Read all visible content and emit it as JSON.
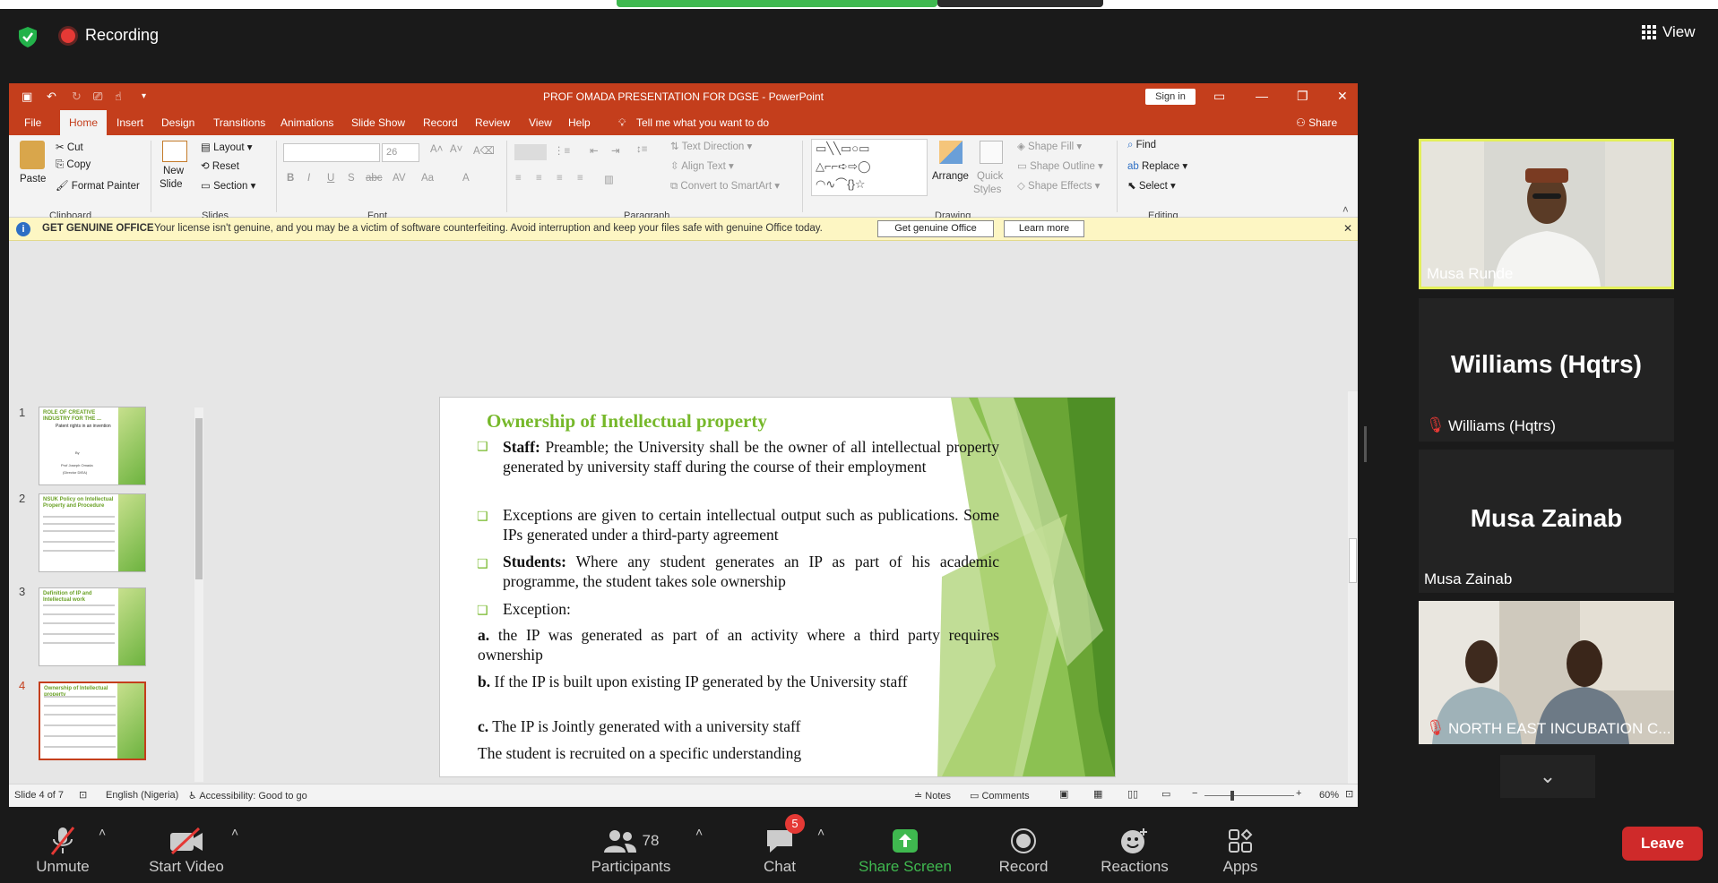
{
  "zoom": {
    "recording_label": "Recording",
    "view_label": "View",
    "leave_label": "Leave",
    "controls": {
      "unmute": "Unmute",
      "start_video": "Start Video",
      "participants": "Participants",
      "participants_count": "78",
      "chat": "Chat",
      "chat_badge": "5",
      "share_screen": "Share Screen",
      "record": "Record",
      "reactions": "Reactions",
      "apps": "Apps"
    },
    "tiles": [
      {
        "name": "Musa Runde"
      },
      {
        "big_name": "Williams (Hqtrs)",
        "name": "Williams (Hqtrs)"
      },
      {
        "big_name": "Musa Zainab",
        "name": "Musa Zainab"
      },
      {
        "name": "NORTH EAST INCUBATION C..."
      }
    ],
    "colors": {
      "accent_green": "#3fb84f",
      "active_speaker": "#e3ef5a",
      "leave": "#cf2a2a"
    }
  },
  "ppt": {
    "title": "PROF OMADA PRESENTATION FOR DGSE  -  PowerPoint",
    "sign_in": "Sign in",
    "share": "Share",
    "tabs": [
      "File",
      "Home",
      "Insert",
      "Design",
      "Transitions",
      "Animations",
      "Slide Show",
      "Record",
      "Review",
      "View",
      "Help"
    ],
    "tell_me": "Tell me what you want to do",
    "ribbon": {
      "paste": "Paste",
      "cut": "Cut",
      "copy": "Copy",
      "format_painter": "Format Painter",
      "clipboard": "Clipboard",
      "new_slide": "New",
      "new_slide2": "Slide",
      "layout": "Layout",
      "reset": "Reset",
      "section": "Section",
      "slides": "Slides",
      "font_size": "26",
      "font": "Font",
      "text_direction": "Text Direction",
      "align_text": "Align Text",
      "convert_smartart": "Convert to SmartArt",
      "paragraph": "Paragraph",
      "arrange": "Arrange",
      "quick_styles": "Quick",
      "quick_styles2": "Styles",
      "shape_fill": "Shape Fill",
      "shape_outline": "Shape Outline",
      "shape_effects": "Shape Effects",
      "drawing": "Drawing",
      "find": "Find",
      "replace": "Replace",
      "select": "Select",
      "editing": "Editing"
    },
    "license": {
      "heading": "GET GENUINE OFFICE",
      "message": "Your license isn't genuine, and you may be a victim of software counterfeiting. Avoid interruption and keep your files safe with genuine Office today.",
      "btn_get": "Get genuine Office",
      "btn_learn": "Learn more"
    },
    "thumbnails": [
      {
        "num": "1",
        "title": "ROLE OF CREATIVE INDUSTRY FOR THE ...",
        "sub": "Patent rights in an invention",
        "by": "By",
        "author": "Prof Joseph Omada",
        "role": "(Director DIEA)"
      },
      {
        "num": "2",
        "title": "NSUK Policy on Intellectual Property and Procedure"
      },
      {
        "num": "3",
        "title": "Definition of IP and Intellectual work"
      },
      {
        "num": "4",
        "title": "Ownership of Intellectual property"
      }
    ],
    "slide": {
      "title": "Ownership of Intellectual property",
      "p1_bold": "Staff:",
      "p1": " Preamble; the University shall be the owner of all intellectual property generated by university staff during the course of their employment",
      "p2": "Exceptions are given to certain intellectual output such as publications. Some IPs generated under a third-party agreement",
      "p3_bold": "Students:",
      "p3": " Where any student generates an IP as part of his academic programme, the student takes sole ownership",
      "p4": "Exception:",
      "a_bold": "a.",
      "a": " the IP was generated as part of an activity where a third party requires ownership",
      "b_bold": "b.",
      "b": " If the IP is built upon existing IP generated by the University staff",
      "c_bold": "c.",
      "c": " The IP is Jointly generated with a university staff",
      "last": "The student is recruited on a specific understanding"
    },
    "status": {
      "slide_of": "Slide 4 of 7",
      "language": "English (Nigeria)",
      "accessibility": "Accessibility: Good to go",
      "notes": "Notes",
      "comments": "Comments",
      "zoom": "60%"
    }
  }
}
